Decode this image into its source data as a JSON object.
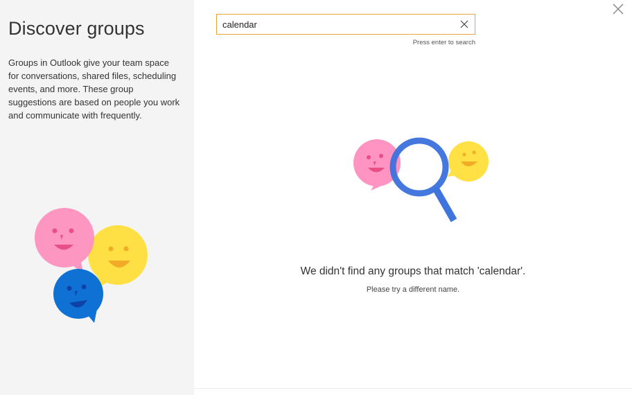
{
  "sidebar": {
    "title": "Discover groups",
    "description": "Groups in Outlook give your team space for conversations, shared files, scheduling events, and more. These group suggestions are based on people you work and communicate with frequently.",
    "illustration": "group-chat-bubbles-icon"
  },
  "search": {
    "value": "calendar",
    "placeholder": "",
    "hint": "Press enter to search",
    "clear_icon": "close-icon"
  },
  "results": {
    "empty_title": "We didn't find any groups that match 'calendar'.",
    "empty_subtitle": "Please try a different name.",
    "illustration": "magnifier-search-icon"
  },
  "window": {
    "close_icon": "close-icon"
  },
  "colors": {
    "sidebar_bg": "#f4f4f4",
    "search_border": "#e8a33a",
    "pink": "#ff8fbf",
    "yellow": "#ffdf3c",
    "blue": "#0b6fd4",
    "magnifier_blue": "#3f74dd"
  }
}
